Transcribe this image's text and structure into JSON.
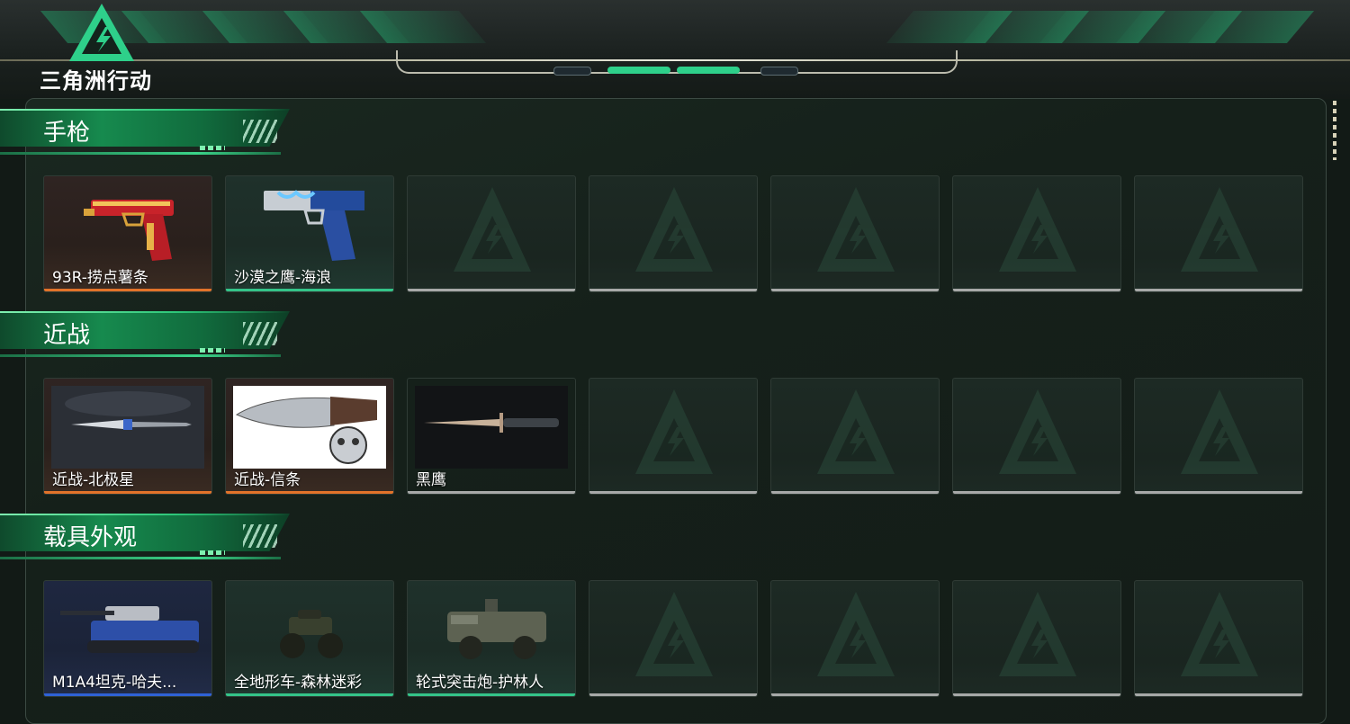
{
  "app": {
    "logo_text": "三角洲行动",
    "accent_color": "#2ed08a"
  },
  "sections": [
    {
      "title": "手枪",
      "items": [
        {
          "name": "93R-捞点薯条",
          "rarity": "orange",
          "icon": "pistol-red-gold"
        },
        {
          "name": "沙漠之鹰-海浪",
          "rarity": "green",
          "icon": "pistol-blue-wave"
        },
        {
          "empty": true
        },
        {
          "empty": true
        },
        {
          "empty": true
        },
        {
          "empty": true
        },
        {
          "empty": true
        }
      ]
    },
    {
      "title": "近战",
      "items": [
        {
          "name": "近战-北极星",
          "rarity": "orange",
          "icon": "knife-polaris"
        },
        {
          "name": "近战-信条",
          "rarity": "orange",
          "icon": "knife-creed"
        },
        {
          "name": "黑鹰",
          "rarity": "grey",
          "icon": "knife-blackhawk"
        },
        {
          "empty": true
        },
        {
          "empty": true
        },
        {
          "empty": true
        },
        {
          "empty": true
        }
      ]
    },
    {
      "title": "载具外观",
      "items": [
        {
          "name": "M1A4坦克-哈夫...",
          "rarity": "blue",
          "icon": "tank"
        },
        {
          "name": "全地形车-森林迷彩",
          "rarity": "green",
          "icon": "atv"
        },
        {
          "name": "轮式突击炮-护林人",
          "rarity": "green",
          "icon": "armored-car"
        },
        {
          "empty": true
        },
        {
          "empty": true
        },
        {
          "empty": true
        },
        {
          "empty": true
        }
      ]
    }
  ]
}
